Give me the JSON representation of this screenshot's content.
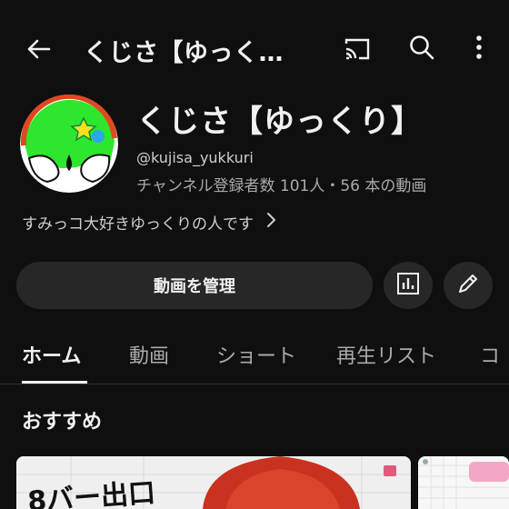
{
  "topbar": {
    "title": "くじさ【ゆっく…"
  },
  "channel": {
    "name": "くじさ【ゆっくり】",
    "handle": "@kujisa_yukkuri",
    "stats": "チャンネル登録者数 101人・56 本の動画",
    "description": "すみっコ大好きゆっくりの人です"
  },
  "actions": {
    "manage_label": "動画を管理"
  },
  "tabs": [
    "ホーム",
    "動画",
    "ショート",
    "再生リスト",
    "コ"
  ],
  "section": {
    "title": "おすすめ"
  },
  "thumbnail": {
    "text": "8バー出口"
  },
  "colors": {
    "background": "#0f0f0f",
    "button": "#272727",
    "avatar_green": "#2ee62e",
    "avatar_ring": "#e0481f"
  }
}
